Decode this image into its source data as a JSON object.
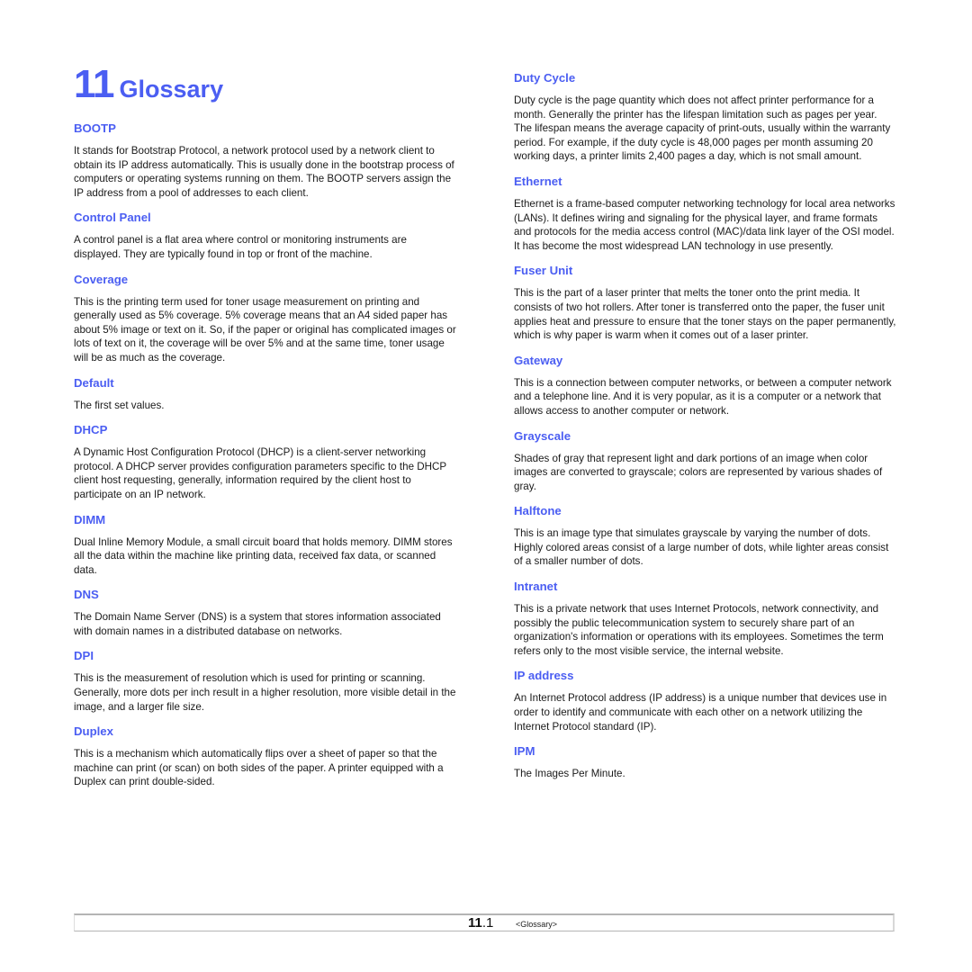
{
  "header": {
    "chapter_number": "11",
    "chapter_title": "Glossary"
  },
  "colors": {
    "accent": "#4b5ef2",
    "body_text": "#1a1a1a",
    "footer_rule": "#b4b4b4"
  },
  "left_column": [
    {
      "term": "BOOTP",
      "definition": "It stands for Bootstrap Protocol, a network protocol used by a network client to obtain its IP address automatically. This is usually done in the bootstrap process of computers or operating systems running on them. The BOOTP servers assign the IP address from a pool of addresses to each client."
    },
    {
      "term": "Control Panel",
      "definition": "A control panel is a flat area where control or monitoring instruments are displayed. They are typically found in top or front of the machine."
    },
    {
      "term": "Coverage",
      "definition": "This is the printing term used for toner usage measurement on printing and generally used as 5% coverage. 5% coverage means that an A4 sided paper has about 5% image or text on it. So, if the paper or original has complicated images or lots of text on it, the coverage will be over 5% and at the same time, toner usage will be as much as the coverage."
    },
    {
      "term": "Default",
      "definition": "The first set values."
    },
    {
      "term": "DHCP",
      "definition": "A Dynamic Host Configuration Protocol (DHCP) is a client-server networking protocol. A DHCP server provides configuration parameters specific to the DHCP client host requesting, generally, information required by the client host to participate on an IP network."
    },
    {
      "term": "DIMM",
      "definition": "Dual Inline Memory Module, a small circuit board that holds memory. DIMM stores all the data within the machine like printing data, received fax data, or scanned data."
    },
    {
      "term": "DNS",
      "definition": "The Domain Name Server (DNS) is a system that stores information associated with domain names in a distributed database on networks."
    },
    {
      "term": "DPI",
      "definition": "This is the measurement of resolution which is used for printing or scanning. Generally, more dots per inch result in a higher resolution, more visible detail in the image, and a larger file size."
    },
    {
      "term": "Duplex",
      "definition": "This is a mechanism which automatically flips over a sheet of paper so that the machine can print (or scan) on both sides of the paper. A printer equipped with a Duplex can print double-sided."
    }
  ],
  "right_column": [
    {
      "term": "Duty Cycle",
      "definition": "Duty cycle is the page quantity which does not affect printer performance for a month. Generally the printer has the lifespan limitation such as pages per year. The lifespan means the average capacity of print-outs, usually within the warranty period. For example, if the duty cycle is 48,000 pages per month assuming 20 working days, a printer limits 2,400 pages a day, which is not small amount."
    },
    {
      "term": "Ethernet",
      "definition": "Ethernet is a frame-based computer networking technology for local area networks (LANs). It defines wiring and signaling for the physical layer, and frame formats and protocols for the media access control (MAC)/data link layer of the OSI model. It has become the most widespread LAN technology in use presently."
    },
    {
      "term": "Fuser Unit",
      "definition": "This is the part of a laser printer that melts the toner onto the print media. It consists of two hot rollers. After toner is transferred onto the paper, the fuser unit applies heat and pressure to ensure that the toner stays on the paper permanently, which is why paper is warm when it comes out of a laser printer."
    },
    {
      "term": "Gateway",
      "definition": "This is a connection between computer networks, or between a computer network and a telephone line. And it is very popular, as it is a computer or a network that allows access to another computer or network."
    },
    {
      "term": "Grayscale",
      "definition": "Shades of gray that represent light and dark portions of an image when color images are converted to grayscale; colors are represented by various shades of gray."
    },
    {
      "term": "Halftone",
      "definition": "This is an image type that simulates grayscale by varying the number of dots. Highly colored areas consist of a large number of dots, while lighter areas consist of a smaller number of dots."
    },
    {
      "term": "Intranet",
      "definition": "This is a private network that uses Internet Protocols, network connectivity, and possibly the public telecommunication system to securely share part of an organization's information or operations with its employees. Sometimes the term refers only to the most visible service, the internal website."
    },
    {
      "term": "IP address",
      "definition": "An Internet Protocol address (IP address) is a unique number that devices use in order to identify and communicate with each other on a network utilizing the Internet Protocol standard (IP)."
    },
    {
      "term": "IPM",
      "definition": "The Images Per Minute."
    }
  ],
  "footer": {
    "chapter": "11",
    "separator": ".",
    "page": "1",
    "section_label": "<Glossary>"
  }
}
